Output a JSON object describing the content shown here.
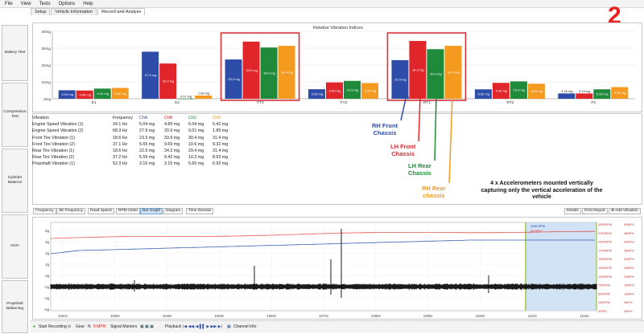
{
  "menu": [
    "File",
    "View",
    "Tests",
    "Options",
    "Help"
  ],
  "tabs": [
    "Setup",
    "Vehicle Information",
    "Record and Analyse"
  ],
  "sidebar": [
    "Battery Test",
    "Compression Test",
    "Cylinder Balance",
    "NVH",
    "Propshaft Balancing"
  ],
  "slide_number": "2",
  "chart_data": [
    {
      "type": "bar",
      "title": "Relative Vibration Indices",
      "ylabel": "",
      "ylim": [
        0,
        40
      ],
      "y_ticks": [
        "0mg",
        "10mg",
        "20mg",
        "30mg",
        "40mg"
      ],
      "categories": [
        "E1",
        "E2",
        "FT1",
        "FT2",
        "RT1",
        "RT2",
        "P1"
      ],
      "series": [
        {
          "name": "ChA",
          "color": "#2e4da8",
          "values": [
            5.04,
            27.9,
            23.3,
            5.65,
            22.9,
            5.59,
            3.16
          ]
        },
        {
          "name": "ChB",
          "color": "#e0262a",
          "values": [
            4.89,
            20.9,
            33.9,
            9.69,
            34.3,
            9.42,
            3.15
          ]
        },
        {
          "name": "ChC",
          "color": "#1f8a3a",
          "values": [
            6.04,
            0.01,
            30.4,
            10.6,
            29.4,
            10.3,
            5.6
          ]
        },
        {
          "name": "ChD",
          "color": "#f39a1f",
          "values": [
            6.42,
            1.89,
            31.4,
            9.32,
            31.4,
            8.93,
            6.92
          ]
        }
      ],
      "bar_labels": [
        [
          "5.04 mg",
          "4.89 mg",
          "6.04 mg",
          "6.42 mg"
        ],
        [
          "27.9 mg",
          "20.9 mg",
          "0.01 mg",
          "1.89 mg"
        ],
        [
          "23.3 mg",
          "33.9 mg",
          "30.4 mg",
          "31.4 mg"
        ],
        [
          "5.65 mg",
          "9.69 mg",
          "10.6 mg",
          "9.32 mg"
        ],
        [
          "22.9 mg",
          "34.3 mg",
          "29.4 mg",
          "31.4 mg"
        ],
        [
          "5.59 mg",
          "9.42 mg",
          "10.3 mg",
          "8.93 mg"
        ],
        [
          "3.16 mg",
          "3.15 mg",
          "5.60 mg",
          "6.92 mg"
        ]
      ]
    },
    {
      "type": "line",
      "title": "",
      "x_ticks": [
        "1020s",
        "1030s",
        "1040s",
        "1050s",
        "1060s",
        "1070s",
        "1080s",
        "1090s",
        "1100s",
        "1110s",
        "1115s"
      ],
      "left_ticks": [
        "8g",
        "6g",
        "4g",
        "2g",
        "0g",
        "-2g",
        "-4g",
        "-6g"
      ],
      "right_ticks_rpm": [
        "2500RPM",
        "2250RPM",
        "2000RPM",
        "1750RPM",
        "1500RPM",
        "1250RPM",
        "1000RPM",
        "750RPM",
        "500RPM",
        "250RPM",
        "0RPM"
      ],
      "right_ticks_mph": [
        "50MPH",
        "45MPH",
        "40MPH",
        "35MPH",
        "30MPH",
        "25MPH",
        "20MPH",
        "15MPH",
        "10MPH",
        "5MPH",
        "0MPH"
      ],
      "series": [
        {
          "color": "#e05555",
          "description": "engine speed trace"
        },
        {
          "color": "#3d5fb0",
          "description": "road speed trace"
        },
        {
          "color": "#000000",
          "description": "vibration signal"
        }
      ],
      "selection_labels": [
        "2045 RPM",
        "60 MPH"
      ]
    }
  ],
  "table": {
    "headers": [
      "Vibration",
      "Frequency",
      "ChA",
      "ChB",
      "ChC",
      "ChD"
    ],
    "header_colors": [
      "#222222",
      "#222222",
      "#2e4da8",
      "#e0262a",
      "#1f8a3a",
      "#f39a1f"
    ],
    "rows": [
      [
        "Engine Speed Vibration (1)",
        "34.1 Hz",
        "5.04 mg",
        "4.89 mg",
        "6.04 mg",
        "6.42 mg"
      ],
      [
        "Engine Speed Vibration (2)",
        "68.3 Hz",
        "27.9 mg",
        "20.9 mg",
        "0.01 mg",
        "1.89 mg"
      ],
      [
        "Front Tire Vibration (1)",
        "18.6 Hz",
        "23.3 mg",
        "33.9 mg",
        "30.4 mg",
        "31.4 mg"
      ],
      [
        "Front Tire Vibration (2)",
        "37.1 Hz",
        "5.65 mg",
        "9.69 mg",
        "10.6 mg",
        "9.32 mg"
      ],
      [
        "Rear Tire Vibration (1)",
        "18.6 Hz",
        "22.9 mg",
        "34.3 mg",
        "29.4 mg",
        "31.4 mg"
      ],
      [
        "Rear Tire Vibration (2)",
        "37.2 Hz",
        "5.59 mg",
        "9.42 mg",
        "10.3 mg",
        "8.93 mg"
      ],
      [
        "Propshaft Vibration (1)",
        "52.3 Hz",
        "3.16 mg",
        "3.15 mg",
        "5.60 mg",
        "6.92 mg"
      ]
    ]
  },
  "annotations": {
    "rh_front": "RH Front\nChassis",
    "lh_front": "LH Front\nChassis",
    "lh_rear": "LH Rear\nChassis",
    "rh_rear": "RH Rear\nchassis",
    "note": "4 x Accelerometers mounted vertically\ncapturing only the vertical acceleration of the\nvehicle"
  },
  "colors": {
    "highlight_box": "#d9323a",
    "arrow_blue": "#2e4da8",
    "arrow_red": "#e0262a",
    "arrow_green": "#1f8a3a",
    "arrow_orange": "#f39a1f"
  },
  "toolbar": {
    "left": [
      "Frequency",
      "3D Frequency",
      "Road Speed",
      "RPM Order",
      "Bar Graph",
      "Diagram",
      "Time Domain"
    ],
    "right": [
      "Details",
      "Print Report",
      "Add Vibration"
    ],
    "active": "Bar Graph"
  },
  "status": {
    "start_recording": "Start Recording",
    "gear_label": "Gear",
    "gear_value": "N",
    "speed": "0 MPH",
    "signal_markers": "Signal Markers",
    "playback": "Playback",
    "channel_info": "Channel Info"
  }
}
